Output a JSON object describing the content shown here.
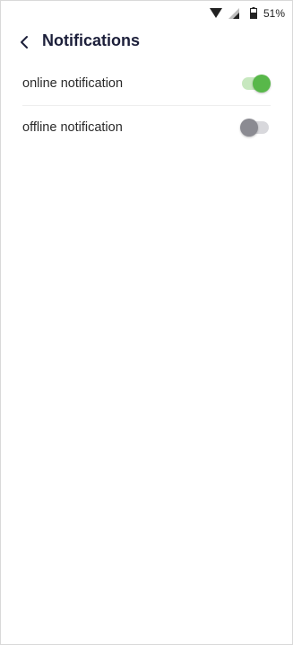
{
  "status_bar": {
    "battery_text": "51%",
    "icons": [
      "wifi-icon",
      "cellular-signal-icon",
      "battery-icon"
    ]
  },
  "header": {
    "title": "Notifications",
    "back_icon": "chevron-left-icon"
  },
  "settings": [
    {
      "label": "online notification",
      "enabled": true
    },
    {
      "label": "offline notification",
      "enabled": false
    }
  ],
  "colors": {
    "title": "#1c1f3a",
    "toggle_on_thumb": "#58b84a",
    "toggle_on_track": "#c7e8bf",
    "toggle_off_thumb": "#8b8b92",
    "toggle_off_track": "#d8d8dc"
  }
}
